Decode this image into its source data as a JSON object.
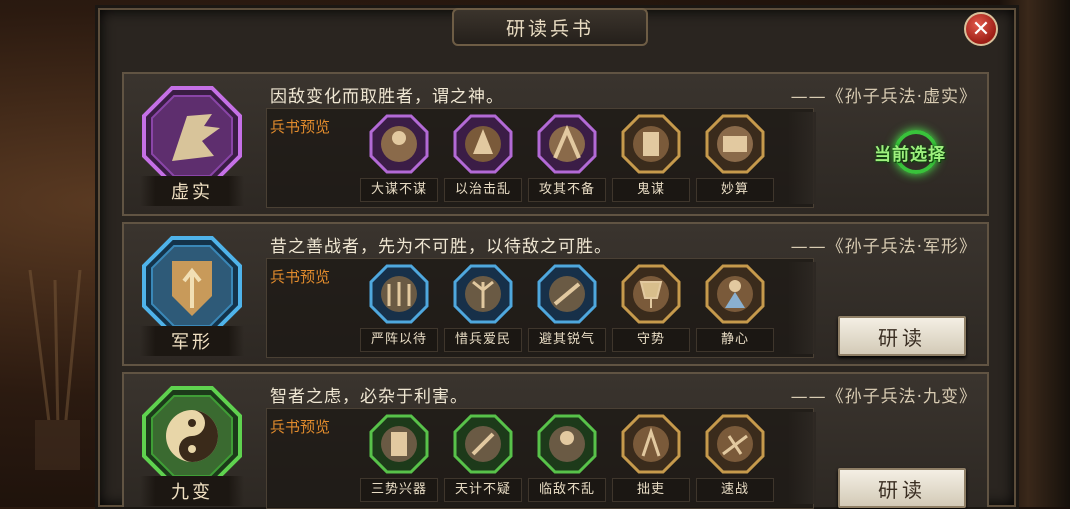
{
  "window": {
    "title": "研读兵书"
  },
  "accent_colors": {
    "purple": "#9b3fbf",
    "blue": "#3a9ad8",
    "green": "#3fae3a",
    "gold": "#c69a4c",
    "selected_text": "#9df07d"
  },
  "books": [
    {
      "name": "虚实",
      "color": "#9b3fbf",
      "quote": "因敌变化而取胜者，谓之神。",
      "source": "——《孙子兵法·虚实》",
      "preview_label": "兵书预览",
      "skills": [
        {
          "name": "大谋不谋",
          "tier": "purple"
        },
        {
          "name": "以治击乱",
          "tier": "purple"
        },
        {
          "name": "攻其不备",
          "tier": "purple"
        },
        {
          "name": "鬼谋",
          "tier": "gold"
        },
        {
          "name": "妙算",
          "tier": "gold"
        }
      ],
      "status": "当前选择"
    },
    {
      "name": "军形",
      "color": "#3a9ad8",
      "quote": "昔之善战者，先为不可胜，以待敌之可胜。",
      "source": "——《孙子兵法·军形》",
      "preview_label": "兵书预览",
      "skills": [
        {
          "name": "严阵以待",
          "tier": "blue"
        },
        {
          "name": "惜兵爱民",
          "tier": "blue"
        },
        {
          "name": "避其锐气",
          "tier": "blue"
        },
        {
          "name": "守势",
          "tier": "gold"
        },
        {
          "name": "静心",
          "tier": "gold"
        }
      ],
      "button": "研读"
    },
    {
      "name": "九变",
      "color": "#3fae3a",
      "quote": "智者之虑，必杂于利害。",
      "source": "——《孙子兵法·九变》",
      "preview_label": "兵书预览",
      "skills": [
        {
          "name": "三势兴器",
          "tier": "green"
        },
        {
          "name": "天计不疑",
          "tier": "green"
        },
        {
          "name": "临敌不乱",
          "tier": "green"
        },
        {
          "name": "拙吏",
          "tier": "gold"
        },
        {
          "name": "速战",
          "tier": "gold"
        }
      ],
      "button": "研读"
    }
  ]
}
